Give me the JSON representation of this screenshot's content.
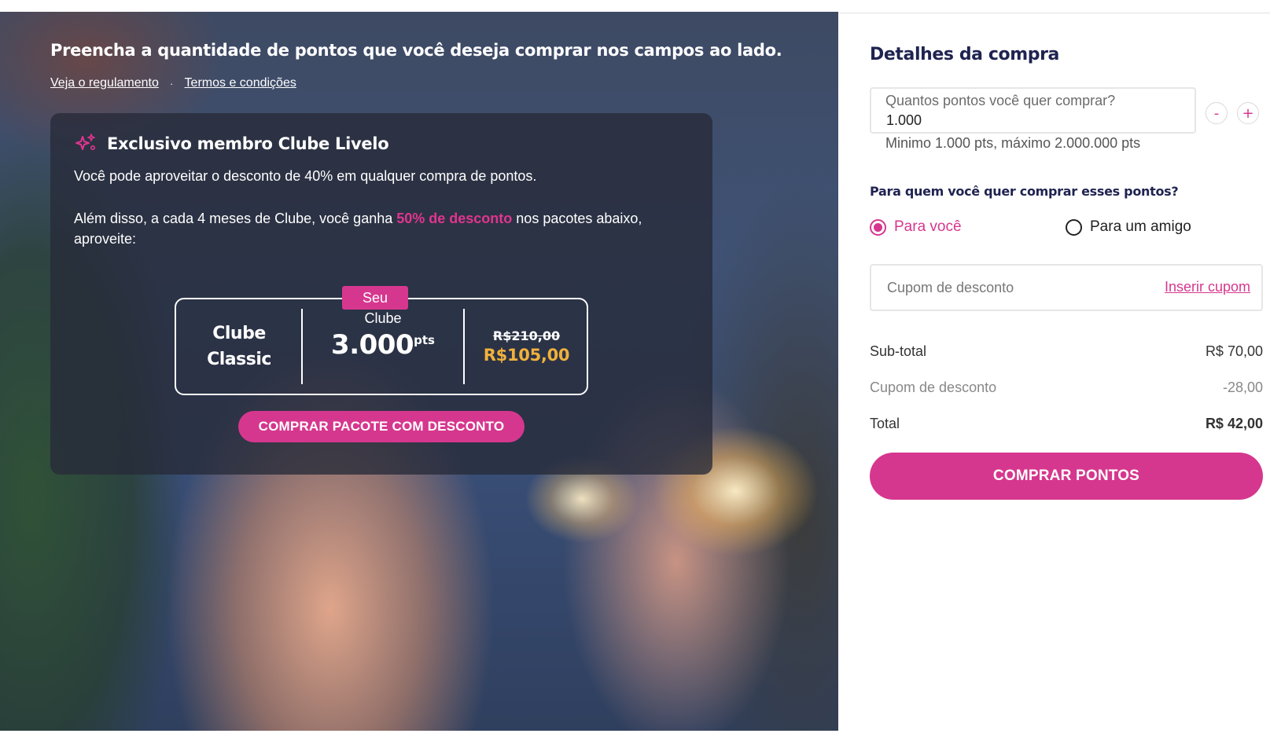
{
  "hero": {
    "headline": "Preencha a quantidade de pontos que você deseja comprar nos campos ao lado.",
    "links": {
      "regulation": "Veja o regulamento",
      "separator": "·",
      "terms": "Termos e condições"
    },
    "club": {
      "icon": "sparkle-icon",
      "title": "Exclusivo membro Clube Livelo",
      "p1": "Você pode aproveitar o desconto de 40% em qualquer compra de pontos.",
      "p2_before": "Além disso, a cada 4 meses de Clube, você ganha ",
      "p2_highlight": "50% de desconto",
      "p2_after": " nos pacotes abaixo, aproveite:",
      "package": {
        "badge": "Seu",
        "plan_line1": "Clube",
        "plan_line2": "Classic",
        "points_label": "Clube",
        "points_value": "3.000",
        "points_unit": "pts",
        "old_price": "R$210,00",
        "new_price": "R$105,00"
      },
      "buy_label": "COMPRAR PACOTE COM DESCONTO"
    }
  },
  "panel": {
    "title": "Detalhes da compra",
    "quantity": {
      "label": "Quantos pontos você quer comprar?",
      "value": "1.000",
      "minus": "-",
      "plus": "+",
      "hint": "Minimo 1.000 pts, máximo 2.000.000 pts"
    },
    "recipient": {
      "question": "Para quem você quer comprar esses pontos?",
      "options": [
        {
          "label": "Para você",
          "selected": true
        },
        {
          "label": "Para um amigo",
          "selected": false
        }
      ]
    },
    "coupon": {
      "placeholder": "Cupom de desconto",
      "link": "Inserir cupom"
    },
    "summary": {
      "subtotal_label": "Sub-total",
      "subtotal_value": "R$ 70,00",
      "coupon_label": "Cupom de desconto",
      "coupon_value": "-28,00",
      "total_label": "Total",
      "total_value": "R$ 42,00"
    },
    "buy_label": "COMPRAR PONTOS"
  },
  "colors": {
    "accent": "#d6378e",
    "navy": "#1f2350",
    "price_highlight": "#f0b13c"
  }
}
